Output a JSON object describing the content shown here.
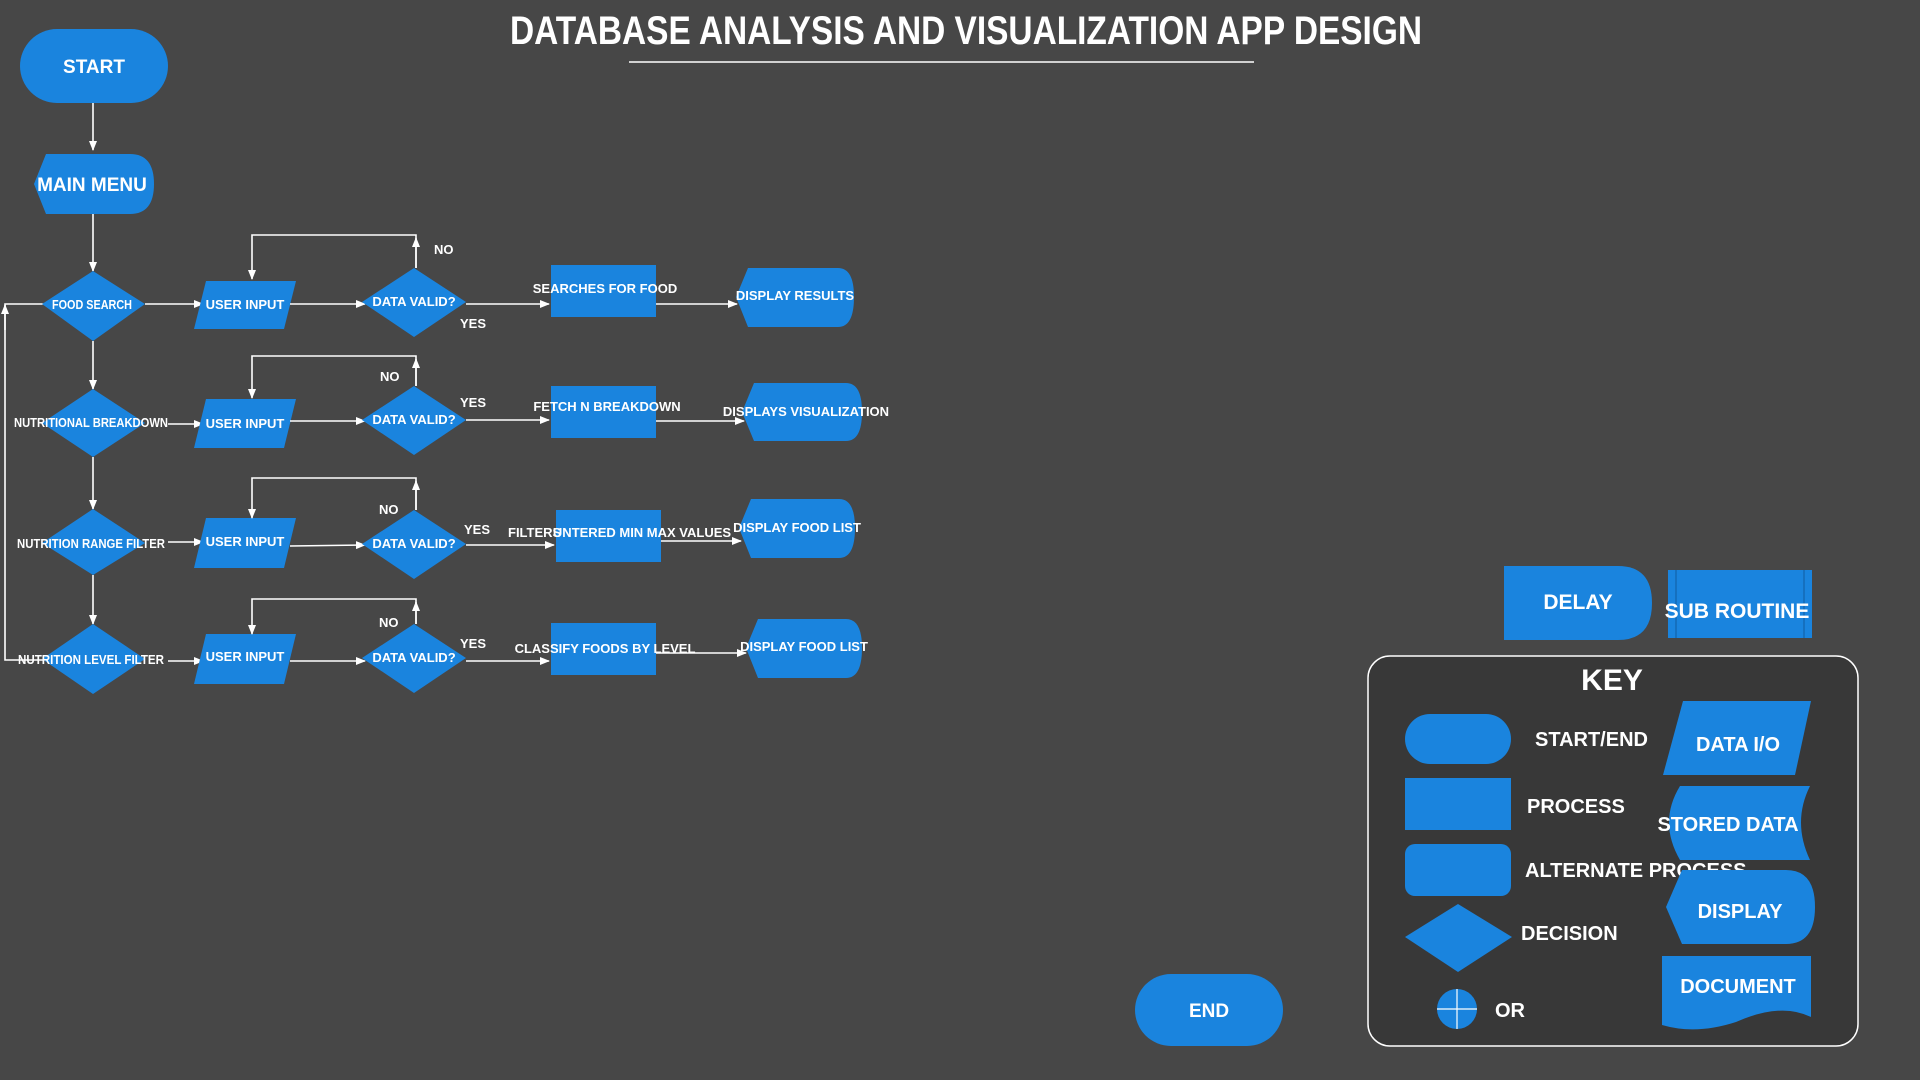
{
  "title": "DATABASE ANALYSIS AND VISUALIZATION APP DESIGN",
  "nodes": {
    "start": "START",
    "main_menu": "MAIN MENU",
    "end": "END",
    "delay": "DELAY",
    "sub_routine": "SUB ROUTINE"
  },
  "rows": [
    {
      "decision": "FOOD SEARCH",
      "input": "USER INPUT",
      "valid": "DATA VALID?",
      "no": "NO",
      "yes": "YES",
      "process": "SEARCHES FOR FOOD",
      "filters": "",
      "display": "DISPLAY RESULTS"
    },
    {
      "decision": "NUTRITIONAL BREAKDOWN",
      "input": "USER INPUT",
      "valid": "DATA VALID?",
      "no": "NO",
      "yes": "YES",
      "process": "FETCH N BREAKDOWN",
      "filters": "",
      "display": "DISPLAYS VISUALIZATION"
    },
    {
      "decision": "NUTRITION RANGE FILTER",
      "input": "USER INPUT",
      "valid": "DATA VALID?",
      "no": "NO",
      "yes": "YES",
      "process": "UNTERED MIN MAX VALUES",
      "filters": "FILTERS",
      "display": "DISPLAY FOOD LIST"
    },
    {
      "decision": "NUTRITION LEVEL FILTER",
      "input": "USER INPUT",
      "valid": "DATA VALID?",
      "no": "NO",
      "yes": "YES",
      "process": "CLASSIFY FOODS BY LEVEL",
      "filters": "",
      "display": "DISPLAY FOOD LIST"
    }
  ],
  "key": {
    "title": "KEY",
    "start_end": "START/END",
    "process": "PROCESS",
    "alternate_process": "ALTERNATE PROCESS",
    "decision": "DECISION",
    "or": "OR",
    "data_io": "DATA I/O",
    "stored_data": "STORED DATA",
    "display": "DISPLAY",
    "document": "DOCUMENT"
  },
  "colors": {
    "background": "#474747",
    "shape": "#1a84de",
    "key_panel": "#383838",
    "line": "#ffffff"
  }
}
